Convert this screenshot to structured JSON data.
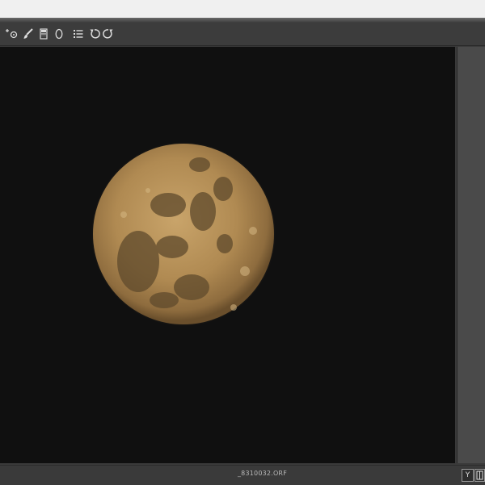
{
  "window": {
    "top_strip": ""
  },
  "toolbar": {
    "tools": [
      {
        "icon": "target-adjustment-icon"
      },
      {
        "icon": "red-eye-icon"
      },
      {
        "icon": "adjustment-brush-icon"
      },
      {
        "icon": "graduated-filter-icon"
      },
      {
        "icon": "radial-filter-icon"
      },
      {
        "icon": "preferences-list-icon"
      },
      {
        "icon": "rotate-left-icon"
      },
      {
        "icon": "rotate-right-icon"
      }
    ]
  },
  "canvas": {
    "background": "#101010",
    "subject": "full-moon-photo"
  },
  "status_bar": {
    "filename": "_8310032.ORF",
    "y_button_label": "Y",
    "toggle_icon": "before-after-toggle-icon"
  },
  "colors": {
    "toolbar_bg": "#3c3c3c",
    "canvas_bg": "#101010",
    "panel_bg": "#4a4a4a",
    "moon_tone": "#b89058"
  }
}
